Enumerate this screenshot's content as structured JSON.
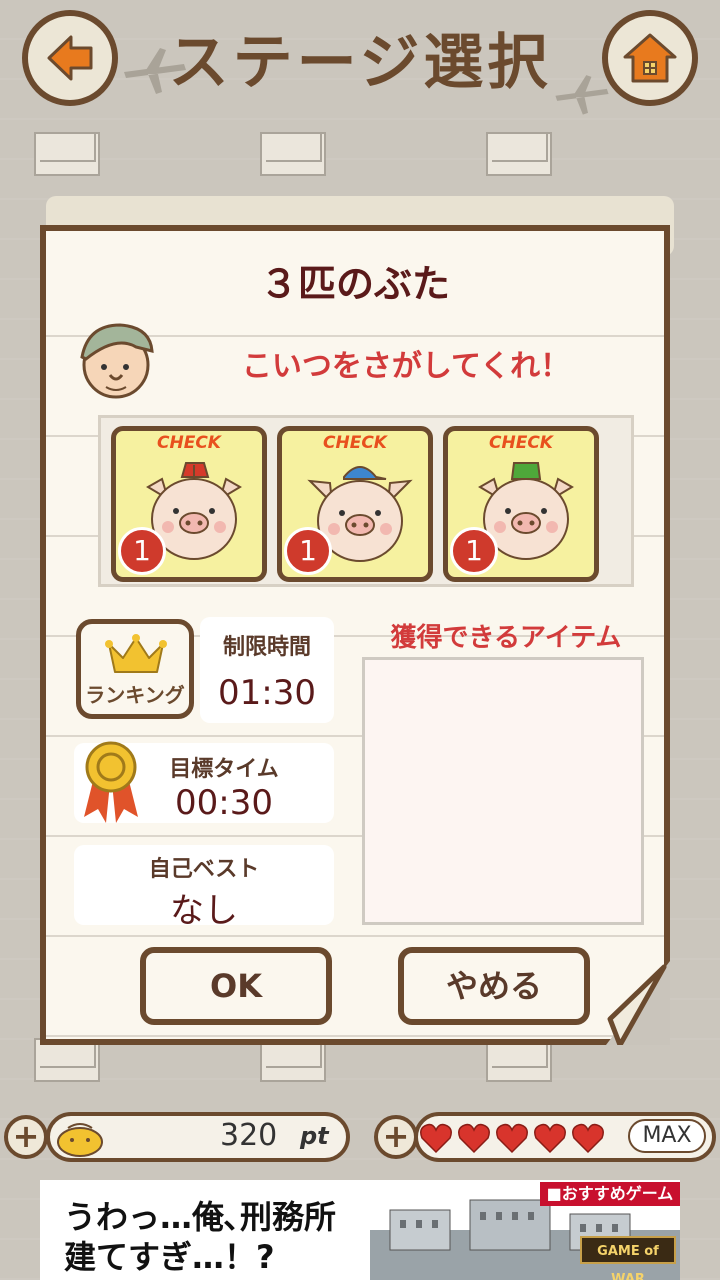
{
  "header": {
    "title": "ステージ選択"
  },
  "modal": {
    "title": "３匹のぶた",
    "request_text": "こいつをさがしてくれ！",
    "targets": [
      {
        "check_label": "CHECK",
        "count": "1",
        "hat_color": "#d63a2a"
      },
      {
        "check_label": "CHECK",
        "count": "1",
        "hat_color": "#3d86d0"
      },
      {
        "check_label": "CHECK",
        "count": "1",
        "hat_color": "#4ea83a"
      }
    ],
    "ranking_label": "ランキング",
    "time_limit_label": "制限時間",
    "time_limit_value": "01:30",
    "goal_time_label": "目標タイム",
    "goal_time_value": "00:30",
    "best_label": "自己ベスト",
    "best_value": "なし",
    "items_label": "獲得できるアイテム",
    "ok_label": "OK",
    "cancel_label": "やめる"
  },
  "bottom_bar": {
    "points_value": "320",
    "points_unit": "pt",
    "hearts_count": 5,
    "hearts_status": "MAX"
  },
  "ad": {
    "line1": "うわっ…俺､刑務所",
    "line2": "建てすぎ…！?",
    "badge": "■おすすめゲーム",
    "logo": "GAME of WAR"
  },
  "colors": {
    "brown": "#6b4a2e",
    "accent_red": "#d23b3b",
    "card_yellow": "#f6f1a0"
  }
}
